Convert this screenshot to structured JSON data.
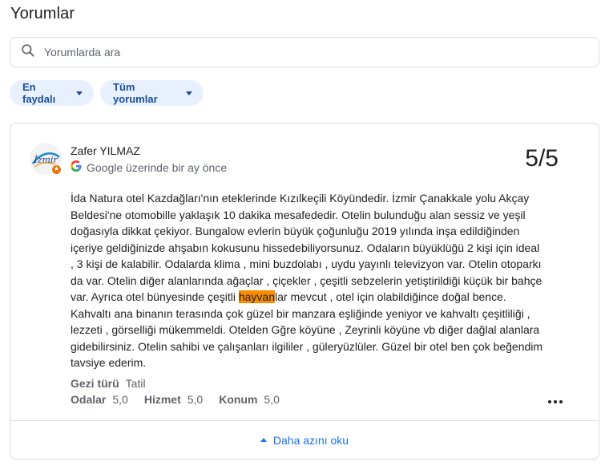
{
  "header": {
    "title": "Yorumlar"
  },
  "search": {
    "placeholder": "Yorumlarda ara"
  },
  "filters": {
    "sort_label": "En faydalı",
    "filter_label": "Tüm yorumlar"
  },
  "review": {
    "avatar_text": "İzmir",
    "author": "Zafer YILMAZ",
    "source": "Google üzerinde bir ay önce",
    "rating": "5/5",
    "text_before": "İda Natura otel Kazdağları'nın eteklerinde Kızılkeçili Köyündedir. İzmir Çanakkale yolu Akçay Beldesi'ne otomobille yaklaşık 10 dakika mesafededir. Otelin bulunduğu alan sessiz ve yeşil doğasıyla dikkat çekiyor. Bungalow evlerin büyük çoğunluğu 2019 yılında inşa edildiğinden içeriye geldiğinizde ahşabın kokusunu hissedebiliyorsunuz. Odaların büyüklüğü 2 kişi için ideal , 3 kişi de kalabilir. Odalarda klima , mini buzdolabı , uydu yayınlı televizyon var. Otelin otoparkı da var. Otelin diğer alanlarında ağaçlar , çiçekler , çeşitli sebzelerin yetiştirildiği küçük bir bahçe var. Ayrıca otel bünyesinde çeşitli ",
    "text_highlight": "hayvan",
    "text_after": "lar mevcut , otel için olabildiğince doğal bence. Kahvaltı ana binanın terasında çok güzel bir manzara eşliğinde yeniyor ve kahvaltı çeşitliliği , lezzeti , görselliği mükemmeldi. Otelden Gğre köyüne , Zeyrinli köyüne vb diğer dağlal alanlara gidebilirsiniz. Otelin sahibi ve çalışanları ilgililer , güleryüzlüler. Güzel bir otel ben çok beğendim tavsiye ederim.",
    "trip_type_label": "Gezi türü",
    "trip_type_value": "Tatil",
    "scores": [
      {
        "label": "Odalar",
        "value": "5,0"
      },
      {
        "label": "Hizmet",
        "value": "5,0"
      },
      {
        "label": "Konum",
        "value": "5,0"
      }
    ],
    "read_less_label": "Daha azını oku"
  },
  "colors": {
    "accent": "#1a73e8",
    "chip_bg": "#e8f0fe",
    "highlight": "#fb8c00",
    "badge": "#e8710a"
  }
}
